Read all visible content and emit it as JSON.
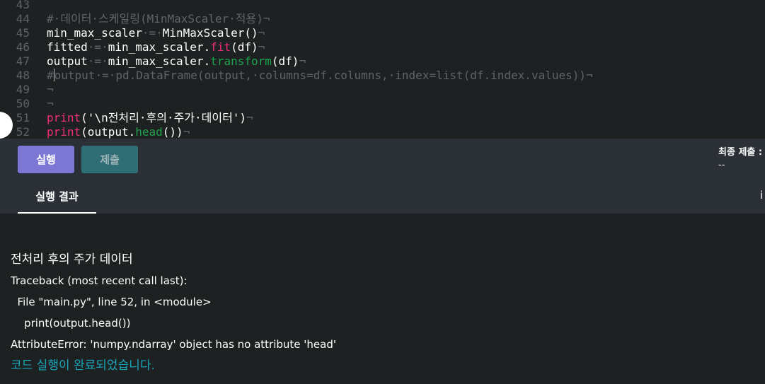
{
  "editor": {
    "lines": [
      {
        "num": "43",
        "tokens": []
      },
      {
        "num": "44",
        "tokens": [
          {
            "t": "#·데이터·스케일링(MinMaxScaler·적용)",
            "c": "comment"
          },
          {
            "t": "¬",
            "c": "eol"
          }
        ]
      },
      {
        "num": "45",
        "tokens": [
          {
            "t": "min_max_scaler",
            "c": "plain"
          },
          {
            "t": "·=·",
            "c": "ws"
          },
          {
            "t": "MinMaxScaler()",
            "c": "plain"
          },
          {
            "t": "¬",
            "c": "eol"
          }
        ]
      },
      {
        "num": "46",
        "tokens": [
          {
            "t": "fitted",
            "c": "plain"
          },
          {
            "t": "·=·",
            "c": "ws"
          },
          {
            "t": "min_max_scaler.",
            "c": "plain"
          },
          {
            "t": "fit",
            "c": "fn"
          },
          {
            "t": "(df)",
            "c": "plain"
          },
          {
            "t": "¬",
            "c": "eol"
          }
        ]
      },
      {
        "num": "47",
        "tokens": [
          {
            "t": "output",
            "c": "plain"
          },
          {
            "t": "·=·",
            "c": "ws"
          },
          {
            "t": "min_max_scaler.",
            "c": "plain"
          },
          {
            "t": "transform",
            "c": "method"
          },
          {
            "t": "(df)",
            "c": "plain"
          },
          {
            "t": "¬",
            "c": "eol"
          }
        ]
      },
      {
        "num": "48",
        "tokens": [
          {
            "t": "#",
            "c": "comment"
          },
          {
            "t": "",
            "c": "cursor"
          },
          {
            "t": "output·=·pd.DataFrame(output,·columns=df.columns,·index=list(df.index.values))",
            "c": "comment"
          },
          {
            "t": "¬",
            "c": "eol"
          }
        ]
      },
      {
        "num": "49",
        "tokens": [
          {
            "t": "¬",
            "c": "eol"
          }
        ]
      },
      {
        "num": "50",
        "tokens": [
          {
            "t": "¬",
            "c": "eol"
          }
        ]
      },
      {
        "num": "51",
        "tokens": [
          {
            "t": "print",
            "c": "fn"
          },
          {
            "t": "('\\n전처리·후의·주가·데이터')",
            "c": "str"
          },
          {
            "t": "¬",
            "c": "eol"
          }
        ]
      },
      {
        "num": "52",
        "tokens": [
          {
            "t": "print",
            "c": "fn"
          },
          {
            "t": "(output.",
            "c": "plain"
          },
          {
            "t": "head",
            "c": "method"
          },
          {
            "t": "())",
            "c": "plain"
          },
          {
            "t": "¬",
            "c": "eol"
          }
        ]
      }
    ]
  },
  "toolbar": {
    "run_label": "실행",
    "submit_label": "제출",
    "final_submit_label": "최종 제출 :",
    "final_submit_value": "--"
  },
  "results": {
    "tab_label": "실행 결과",
    "extra_label": "i",
    "output_lines": [
      "전처리 후의 주가 데이터",
      "Traceback (most recent call last):",
      "  File \"main.py\", line 52, in <module>",
      "    print(output.head())",
      "AttributeError: 'numpy.ndarray' object has no attribute 'head'",
      "코드 실행이 완료되었습니다."
    ]
  },
  "colors": {
    "run_button": "#7c77d4",
    "submit_button": "#2f6e75",
    "comment": "#5f6468",
    "function": "#f12d78",
    "method": "#1fa44d",
    "success_text": "#1aa4b8"
  }
}
